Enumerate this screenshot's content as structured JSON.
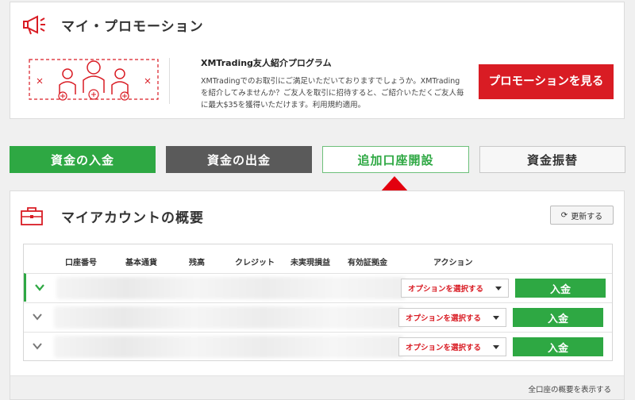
{
  "promotion": {
    "title": "マイ・プロモーション",
    "program_title": "XMTrading友人紹介プログラム",
    "description": "XMTradingでのお取引にご満足いただいておりますでしょうか。XMTradingを紹介してみませんか？ご友人を取引に招待すると、ご紹介いただくご友人毎に最大$35を獲得いただけます。利用規約適用。",
    "button_label": "プロモーションを見る"
  },
  "actions": {
    "deposit": "資金の入金",
    "withdraw": "資金の出金",
    "open_account": "追加口座開設",
    "transfer": "資金振替"
  },
  "account": {
    "title": "マイアカウントの概要",
    "refresh_label": "更新する",
    "columns": [
      "口座番号",
      "基本通貨",
      "残高",
      "クレジット",
      "未実現損益",
      "有効証拠金",
      "アクション"
    ],
    "rows": [
      {
        "option_label": "オプションを選択する",
        "deposit_label": "入金",
        "expanded": true
      },
      {
        "option_label": "オプションを選択する",
        "deposit_label": "入金",
        "expanded": false
      },
      {
        "option_label": "オプションを選択する",
        "deposit_label": "入金",
        "expanded": false
      }
    ],
    "footer_link": "全口座の概要を表示する"
  },
  "colors": {
    "brand_red": "#d91c24",
    "green": "#2ea843",
    "dark_gray": "#5a5a5a"
  },
  "icons": {
    "promo": "megaphone-icon",
    "account": "briefcase-icon",
    "refresh": "refresh-icon",
    "pointer": "up-arrow-icon"
  }
}
